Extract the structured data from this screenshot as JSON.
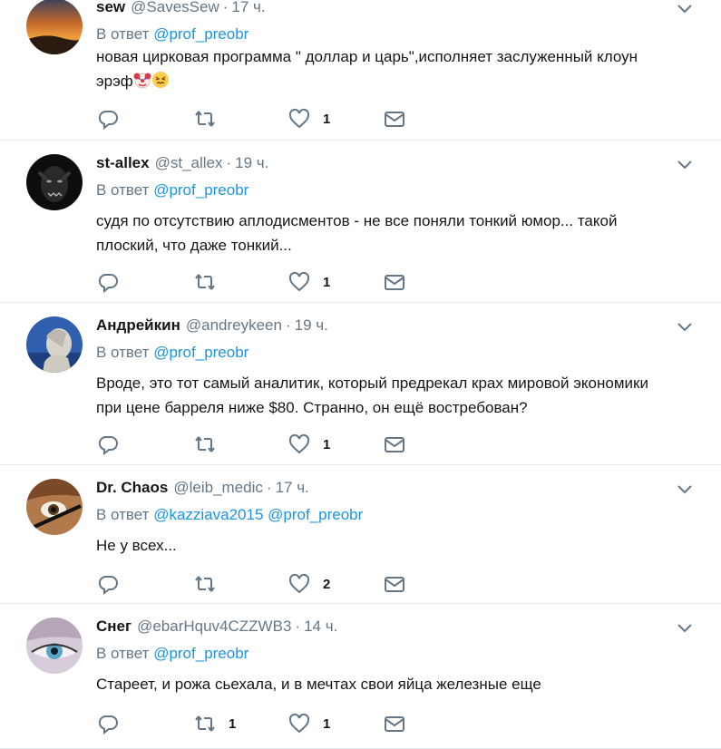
{
  "tweets": [
    {
      "name": "sew",
      "handle": "@SavesSew",
      "time": "17 ч.",
      "reply_prefix": "В ответ",
      "mentions": [
        "@prof_preobr"
      ],
      "text_line1": "новая цирковая программа \" доллар и царь\",исполняет заслуженный клоун",
      "text_line2": "эрэф",
      "emoji": [
        "clown-face",
        "confounded-face"
      ],
      "replies": "",
      "retweets": "",
      "likes": "1"
    },
    {
      "name": "st-allex",
      "handle": "@st_allex",
      "time": "19 ч.",
      "reply_prefix": "В ответ",
      "mentions": [
        "@prof_preobr"
      ],
      "text_line1": "судя по отсутствию аплодисментов - не все поняли тонкий юмор... такой",
      "text_line2": "плоский, что даже тонкий...",
      "replies": "",
      "retweets": "",
      "likes": "1"
    },
    {
      "name": "Андрейкин",
      "handle": "@andreykeen",
      "time": "19 ч.",
      "reply_prefix": "В ответ",
      "mentions": [
        "@prof_preobr"
      ],
      "text_line1": "Вроде, это тот самый аналитик, который предрекал крах мировой экономики",
      "text_line2": "при цене барреля ниже $80. Странно, он ещё востребован?",
      "replies": "",
      "retweets": "",
      "likes": "1"
    },
    {
      "name": "Dr. Chaos",
      "handle": "@leib_medic",
      "time": "17 ч.",
      "reply_prefix": "В ответ",
      "mentions": [
        "@kazziava2015",
        "@prof_preobr"
      ],
      "text_line1": "Не у всех...",
      "text_line2": "",
      "replies": "",
      "retweets": "",
      "likes": "2"
    },
    {
      "name": "Снег",
      "handle": "@ebarHquv4CZZWB3",
      "time": "14 ч.",
      "reply_prefix": "В ответ",
      "mentions": [
        "@prof_preobr"
      ],
      "text_line1": "Стареет, и рожа  сьехала, и в мечтах свои яйца железные еще",
      "text_line2": "",
      "replies": "",
      "retweets": "1",
      "likes": "1"
    }
  ],
  "icons": {
    "reply": "reply-icon",
    "retweet": "retweet-icon",
    "like": "heart-icon",
    "dm": "envelope-icon",
    "more": "chevron-down-icon"
  },
  "colors": {
    "accent": "#1b95e0",
    "muted": "#657786",
    "text": "#14171a",
    "divider": "#e6ecf0"
  }
}
